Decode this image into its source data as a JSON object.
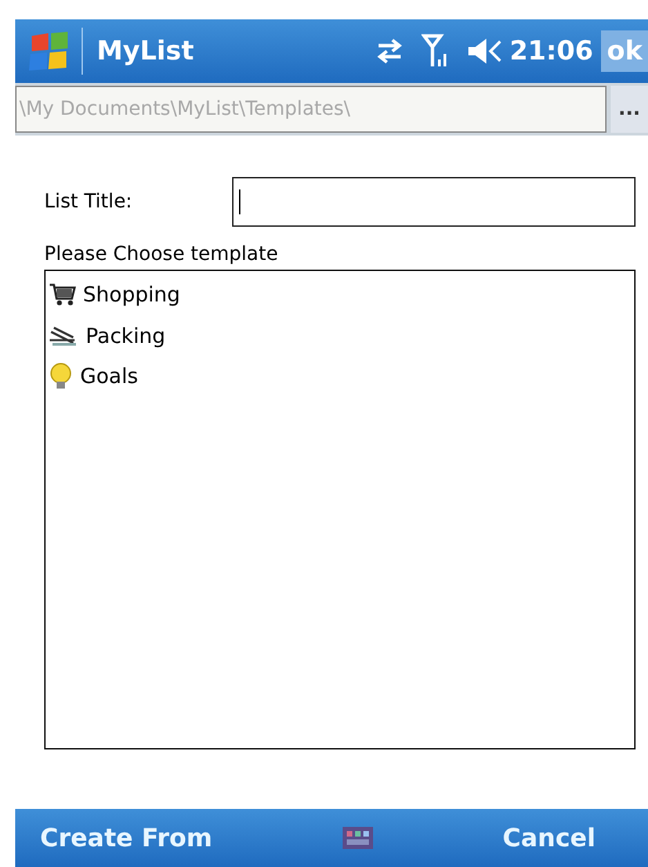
{
  "title_bar": {
    "title": "MyList",
    "time": "21:06",
    "ok": "ok"
  },
  "path_bar": {
    "path": "\\My Documents\\MyList\\Templates\\",
    "browse": "..."
  },
  "form": {
    "list_title_label": "List Title:",
    "choose_label": "Please Choose template"
  },
  "templates": [
    {
      "label": "Shopping",
      "kind": "cart"
    },
    {
      "label": "Packing",
      "kind": "packing"
    },
    {
      "label": "Goals",
      "kind": "bulb"
    }
  ],
  "menu_bar": {
    "left": "Create From",
    "right": "Cancel"
  }
}
